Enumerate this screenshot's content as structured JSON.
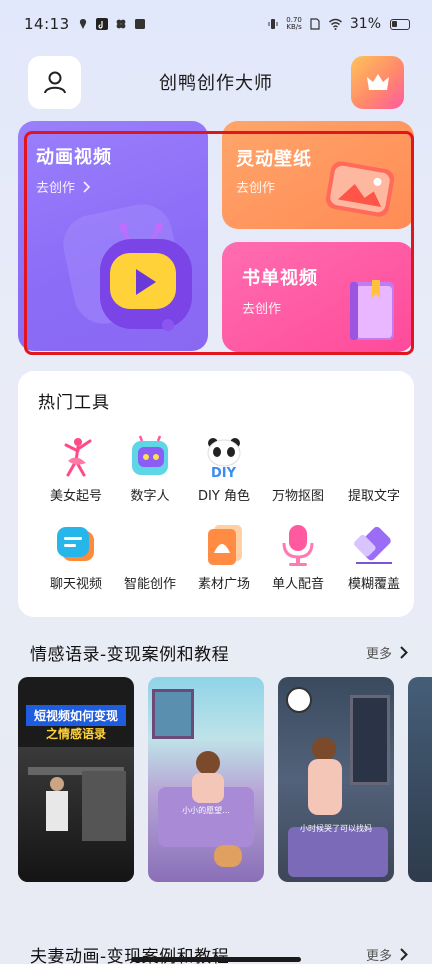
{
  "status_bar": {
    "time": "14:13",
    "net_speed": "0.70",
    "net_unit": "KB/s",
    "battery": "31%"
  },
  "header": {
    "title": "创鸭创作大师",
    "avatar_icon": "user-icon",
    "vip_icon": "crown-icon"
  },
  "cards": {
    "animation": {
      "title": "动画视频",
      "subtitle": "去创作"
    },
    "wallpaper": {
      "title": "灵动壁纸",
      "subtitle": "去创作"
    },
    "book": {
      "title": "书单视频",
      "subtitle": "去创作"
    }
  },
  "tools": {
    "title": "热门工具",
    "items": [
      {
        "label": "美女起号",
        "icon": "dancer-icon"
      },
      {
        "label": "数字人",
        "icon": "robot-icon"
      },
      {
        "label": "DIY 角色",
        "icon": "panda-icon"
      },
      {
        "label": "万物抠图",
        "icon": "cutout-icon"
      },
      {
        "label": "提取文字",
        "icon": "text-extract-icon"
      },
      {
        "label": "聊天视频",
        "icon": "chat-icon"
      },
      {
        "label": "智能创作",
        "icon": "ai-create-icon"
      },
      {
        "label": "素材广场",
        "icon": "material-icon"
      },
      {
        "label": "单人配音",
        "icon": "microphone-icon"
      },
      {
        "label": "模糊覆盖",
        "icon": "eraser-icon"
      }
    ]
  },
  "section_emotion": {
    "title": "情感语录-变现案例和教程",
    "more": "更多",
    "thumbs": [
      {
        "caption_line1": "短视频如何变现",
        "caption_line2": "之情感语录"
      },
      {
        "caption": "小小的愿望..."
      },
      {
        "caption": "小时候哭了可以找妈"
      },
      {
        "caption": ""
      }
    ]
  },
  "section_couple": {
    "title": "夫妻动画-变现案例和教程",
    "more": "更多"
  },
  "colors": {
    "accent_red": "#e0151d",
    "purple": "#8b6cf7",
    "orange": "#ff8b55",
    "pink": "#ff4a9a"
  }
}
